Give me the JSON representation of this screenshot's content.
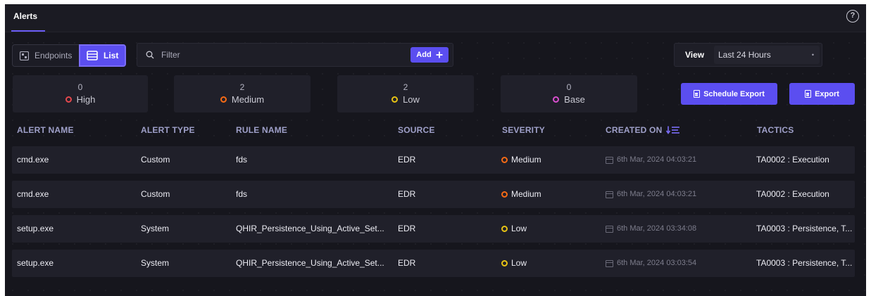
{
  "header": {
    "tab_label": "Alerts",
    "help_label": "?"
  },
  "toolbar": {
    "endpoints_label": "Endpoints",
    "list_label": "List",
    "filter_placeholder": "Filter",
    "add_label": "Add",
    "view_label": "View",
    "view_selected": "Last 24 Hours"
  },
  "counters": [
    {
      "count": "0",
      "label": "High",
      "color": "#e5484d"
    },
    {
      "count": "2",
      "label": "Medium",
      "color": "#f76b15"
    },
    {
      "count": "2",
      "label": "Low",
      "color": "#e8c414"
    },
    {
      "count": "0",
      "label": "Base",
      "color": "#d94fcf"
    }
  ],
  "exports": {
    "schedule_label": "Schedule Export",
    "export_label": "Export"
  },
  "table": {
    "columns": [
      "ALERT NAME",
      "ALERT TYPE",
      "RULE NAME",
      "SOURCE",
      "SEVERITY",
      "CREATED ON",
      "TACTICS"
    ],
    "rows": [
      {
        "alert_name": "cmd.exe",
        "alert_type": "Custom",
        "rule_name": "fds",
        "source": "EDR",
        "severity": "Medium",
        "created_on": "6th Mar, 2024 04:03:21",
        "tactics": "TA0002 : Execution"
      },
      {
        "alert_name": "cmd.exe",
        "alert_type": "Custom",
        "rule_name": "fds",
        "source": "EDR",
        "severity": "Medium",
        "created_on": "6th Mar, 2024 04:03:21",
        "tactics": "TA0002 : Execution"
      },
      {
        "alert_name": "setup.exe",
        "alert_type": "System",
        "rule_name": "QHIR_Persistence_Using_Active_Set...",
        "source": "EDR",
        "severity": "Low",
        "created_on": "6th Mar, 2024 03:34:08",
        "tactics": "TA0003 : Persistence, T..."
      },
      {
        "alert_name": "setup.exe",
        "alert_type": "System",
        "rule_name": "QHIR_Persistence_Using_Active_Set...",
        "source": "EDR",
        "severity": "Low",
        "created_on": "6th Mar, 2024 03:03:54",
        "tactics": "TA0003 : Persistence, T..."
      }
    ]
  },
  "colors": {
    "accent": "#5b4ef0",
    "background": "#16161d",
    "severity_medium": "#f76b15",
    "severity_low": "#e8c414"
  }
}
